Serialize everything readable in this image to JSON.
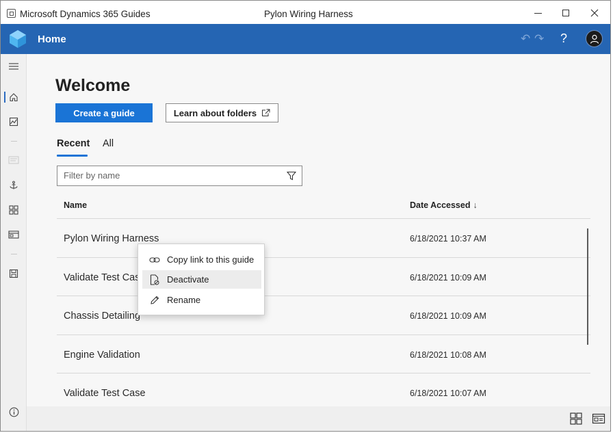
{
  "window": {
    "app_name": "Microsoft Dynamics 365 Guides",
    "document_title": "Pylon Wiring Harness"
  },
  "appbar": {
    "title": "Home",
    "brand_color": "#2565b3"
  },
  "main": {
    "heading": "Welcome",
    "create_button": "Create a guide",
    "learn_button": "Learn about folders",
    "tabs": [
      {
        "label": "Recent",
        "active": true
      },
      {
        "label": "All",
        "active": false
      }
    ],
    "filter_placeholder": "Filter by name",
    "columns": {
      "name": "Name",
      "date": "Date Accessed",
      "sort_indicator": "↓"
    },
    "rows": [
      {
        "name": "Pylon Wiring Harness",
        "date": "6/18/2021 10:37 AM"
      },
      {
        "name": "Validate Test Case",
        "date": "6/18/2021 10:09 AM"
      },
      {
        "name": "Chassis Detailing",
        "date": "6/18/2021 10:09 AM"
      },
      {
        "name": "Engine Validation",
        "date": "6/18/2021 10:08 AM"
      },
      {
        "name": "Validate Test Case",
        "date": "6/18/2021 10:07 AM"
      }
    ]
  },
  "context_menu": {
    "items": [
      {
        "label": "Copy link to this guide",
        "icon": "link-icon"
      },
      {
        "label": "Deactivate",
        "icon": "deactivate-icon"
      },
      {
        "label": "Rename",
        "icon": "pencil-icon"
      }
    ]
  },
  "accent_color": "#1a74d6"
}
